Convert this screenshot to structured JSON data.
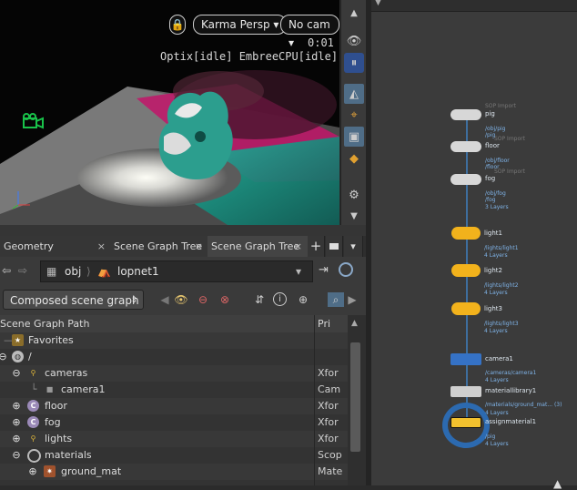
{
  "viewport": {
    "renderer_label": "Karma Persp",
    "camera_label": "No cam",
    "time": "0:01",
    "status": "Optix[idle] EmbreeCPU[idle]"
  },
  "tabs": [
    {
      "label": "Geometry Spreadsheet",
      "close": "×"
    },
    {
      "label": "Scene Graph Tree",
      "close": "×"
    },
    {
      "label": "Scene Graph Tree",
      "close": "×",
      "active": true
    }
  ],
  "tab_tools": {
    "add": "+"
  },
  "pathbar": {
    "context": "obj",
    "node": "lopnet1"
  },
  "filter": {
    "selected": "Composed scene graph"
  },
  "tree": {
    "col_path": "Scene Graph Path",
    "col_pri": "Pri",
    "rows": [
      {
        "name": "Favorites",
        "pri": "",
        "indent": 0
      },
      {
        "name": "/",
        "pri": "",
        "indent": 0
      },
      {
        "name": "cameras",
        "pri": "Xfor",
        "indent": 1
      },
      {
        "name": "camera1",
        "pri": "Cam",
        "indent": 2
      },
      {
        "name": "floor",
        "pri": "Xfor",
        "indent": 1
      },
      {
        "name": "fog",
        "pri": "Xfor",
        "indent": 1
      },
      {
        "name": "lights",
        "pri": "Xfor",
        "indent": 1
      },
      {
        "name": "materials",
        "pri": "Scop",
        "indent": 1
      },
      {
        "name": "ground_mat",
        "pri": "Mate",
        "indent": 2
      }
    ]
  },
  "network": {
    "nodes": [
      {
        "name": "pig",
        "header": "SOP Import",
        "path": "/obj/pig",
        "sub": "/pig",
        "layers": "",
        "kind": "sop"
      },
      {
        "name": "floor",
        "header": "SOP Import",
        "path": "/obj/floor",
        "sub": "/floor",
        "layers": "",
        "kind": "sop"
      },
      {
        "name": "fog",
        "header": "SOP Import",
        "path": "/obj/fog",
        "sub": "/fog",
        "layers": "3 Layers",
        "kind": "sop"
      },
      {
        "name": "light1",
        "header": "",
        "path": "/lights/light1",
        "sub": "",
        "layers": "4 Layers",
        "kind": "light"
      },
      {
        "name": "light2",
        "header": "",
        "path": "/lights/light2",
        "sub": "",
        "layers": "4 Layers",
        "kind": "light"
      },
      {
        "name": "light3",
        "header": "",
        "path": "/lights/light3",
        "sub": "",
        "layers": "4 Layers",
        "kind": "light"
      },
      {
        "name": "camera1",
        "header": "",
        "path": "/cameras/camera1",
        "sub": "",
        "layers": "4 Layers",
        "kind": "camera"
      },
      {
        "name": "materiallibrary1",
        "header": "",
        "path": "/materials/ground_mat... (3)",
        "sub": "",
        "layers": "4 Layers",
        "kind": "matlib"
      },
      {
        "name": "assignmaterial1",
        "header": "",
        "path": "/pig",
        "sub": "",
        "layers": "4 Layers",
        "kind": "assign"
      }
    ],
    "colors": {
      "wire": "#3f8fe0",
      "light": "#f2b21c",
      "camera": "#3572c6",
      "display": "#2c6ab0"
    }
  }
}
